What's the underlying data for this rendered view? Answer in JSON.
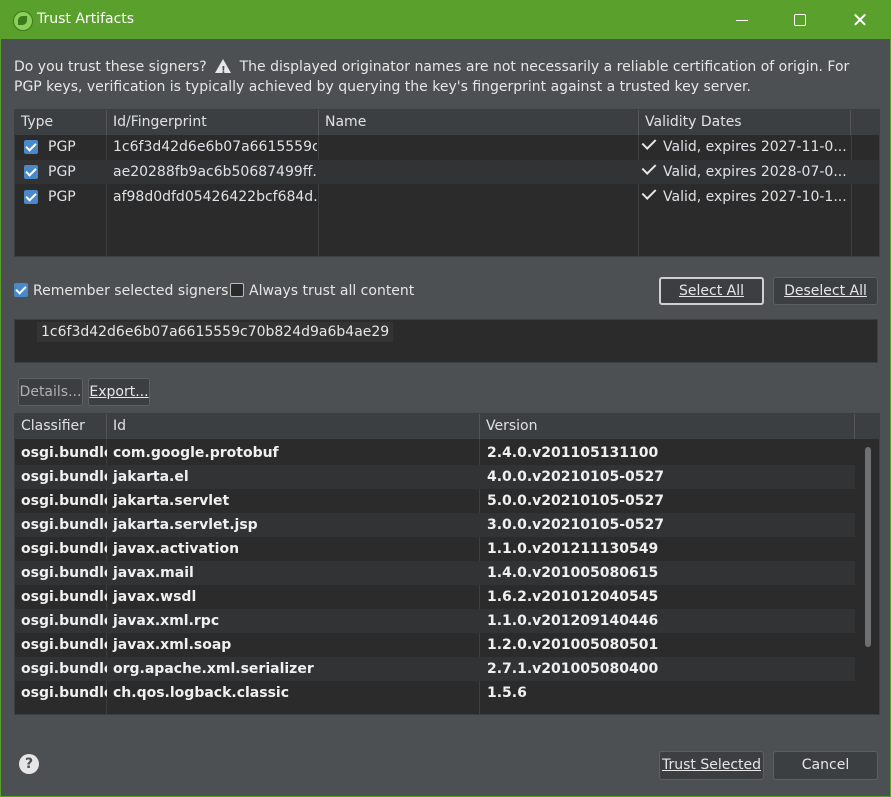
{
  "window": {
    "title": "Trust Artifacts"
  },
  "message": "Do you trust these signers?  ⚠ The displayed originator names are not necessarily a reliable certification of origin.  For PGP keys, verification is typically achieved by querying the key's fingerprint against a trusted key server.",
  "message_parts": {
    "before": "Do you trust these signers?",
    "after": "The displayed originator names are not necessarily a reliable certification of origin.  For PGP keys, verification is typically achieved by querying the key's fingerprint against a trusted key server."
  },
  "signers": {
    "columns": [
      "Type",
      "Id/Fingerprint",
      "Name",
      "Validity Dates"
    ],
    "rows": [
      {
        "type": "PGP",
        "id": "1c6f3d42d6e6b07a6615559c...",
        "name": "",
        "validity": "Valid, expires 2027-11-0..."
      },
      {
        "type": "PGP",
        "id": "ae20288fb9ac6b50687499ff...",
        "name": "",
        "validity": "Valid, expires 2028-07-0..."
      },
      {
        "type": "PGP",
        "id": "af98d0dfd05426422bcf684d...",
        "name": "",
        "validity": "Valid, expires 2027-10-1..."
      }
    ]
  },
  "options": {
    "remember": "Remember selected signers",
    "always_trust": "Always trust all content"
  },
  "buttons": {
    "select_all": "Select All",
    "deselect_all": "Deselect All",
    "details": "Details...",
    "export": "Export...",
    "trust_selected": "Trust Selected",
    "cancel": "Cancel"
  },
  "fingerprint": "1c6f3d42d6e6b07a6615559c70b824d9a6b4ae29",
  "artifacts": {
    "columns": [
      "Classifier",
      "Id",
      "Version"
    ],
    "rows": [
      {
        "classifier": "osgi.bundle",
        "id": "com.google.protobuf",
        "version": "2.4.0.v201105131100"
      },
      {
        "classifier": "osgi.bundle",
        "id": "jakarta.el",
        "version": "4.0.0.v20210105-0527"
      },
      {
        "classifier": "osgi.bundle",
        "id": "jakarta.servlet",
        "version": "5.0.0.v20210105-0527"
      },
      {
        "classifier": "osgi.bundle",
        "id": "jakarta.servlet.jsp",
        "version": "3.0.0.v20210105-0527"
      },
      {
        "classifier": "osgi.bundle",
        "id": "javax.activation",
        "version": "1.1.0.v201211130549"
      },
      {
        "classifier": "osgi.bundle",
        "id": "javax.mail",
        "version": "1.4.0.v201005080615"
      },
      {
        "classifier": "osgi.bundle",
        "id": "javax.wsdl",
        "version": "1.6.2.v201012040545"
      },
      {
        "classifier": "osgi.bundle",
        "id": "javax.xml.rpc",
        "version": "1.1.0.v201209140446"
      },
      {
        "classifier": "osgi.bundle",
        "id": "javax.xml.soap",
        "version": "1.2.0.v201005080501"
      },
      {
        "classifier": "osgi.bundle",
        "id": "org.apache.xml.serializer",
        "version": "2.7.1.v201005080400"
      },
      {
        "classifier": "osgi.bundle",
        "id": "ch.qos.logback.classic",
        "version": "1.5.6"
      }
    ]
  },
  "colors": {
    "accent": "#5aa02c",
    "check": "#4a88c7",
    "background": "#4c5052",
    "table_bg": "#2b2b2b"
  }
}
